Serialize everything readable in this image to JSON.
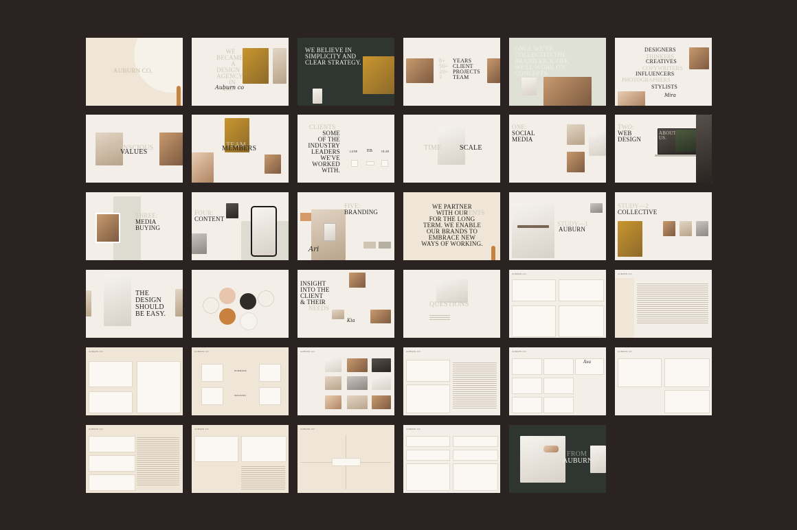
{
  "colors": {
    "background": "#2b2322",
    "cream": "#f3efe8",
    "sand": "#efe6d7",
    "dark_slide": "#2f3530",
    "accent_orange": "#c9813f"
  },
  "slides": {
    "s01": {
      "title": "AUBURN CO."
    },
    "s02": {
      "title": "WE BECAME A DESIGN AGENCY IN 2007",
      "signature": "Auburn co"
    },
    "s03": {
      "title": "WE BELIEVE IN SIMPLICITY AND CLEAR STRATEGY."
    },
    "s04": {
      "numbers": "8+\n50+\n20+\n3",
      "title": "YEARS\nCLIENT\nPROJECTS\nTEAM"
    },
    "s05": {
      "title": "ONCE WE'VE COLLECTED THE BRAND KICK-OFF, WE'LL WORK ON CONCEPTS"
    },
    "s06": {
      "title_1": "DESIGNERS",
      "ghost_1": "THINKERS",
      "title_2": "CREATIVES",
      "ghost_2": "COPYWRITERS",
      "title_3": "INFLUENCERS",
      "ghost_3": "PHOTOGRAPHERS",
      "title_4": "STYLISTS",
      "signature": "Mira"
    },
    "s07": {
      "ghost": "CONSCIOUS",
      "title": "VALUES"
    },
    "s08": {
      "ghost": "TEAM",
      "title": "MEMBERS"
    },
    "s09": {
      "ghost": "CLIENTS",
      "title": "SOME\nOF THE\nINDUSTRY\nLEADERS\nWE'VE\nWORKED\nWITH.",
      "logos": [
        "LUNE",
        "EB",
        "OLAE",
        "",
        "",
        ""
      ]
    },
    "s10": {
      "ghost": "TIME",
      "title": "SCALE"
    },
    "s11": {
      "ghost": "ONE:",
      "title": "SOCIAL\nMEDIA"
    },
    "s12": {
      "ghost": "TWO:",
      "title": "WEB\nDESIGN",
      "ghost_2": "ABOUT\nUS."
    },
    "s13": {
      "ghost": "THREE:",
      "title": "MEDIA\nBUYING"
    },
    "s14": {
      "ghost": "FOUR:",
      "title": "CONTENT"
    },
    "s15": {
      "ghost": "FIVE:",
      "title": "BRANDING",
      "signature": "Ari"
    },
    "s16": {
      "title_1": "WE PARTNER\nWITH OUR",
      "ghost": "CLIENTS",
      "title_2": "FOR THE LONG\nTERM. WE ENABLE\nOUR BRANDS TO\nEMBRACE NEW\nWAYS OF WORKING."
    },
    "s17": {
      "ghost": "STUDY—1",
      "title": "AUBURN"
    },
    "s18": {
      "ghost": "STUDY—2",
      "title": "COLLECTIVE"
    },
    "s19": {
      "title": "THE\nDESIGN\nSHOULD\nBE EASY."
    },
    "s20": {
      "circles": [
        "",
        "",
        "",
        ""
      ]
    },
    "s21": {
      "title": "INSIGHT\nINTO THE\nCLIENT\n& THEIR",
      "ghost": "NEEDS",
      "signature": "Kia"
    },
    "s22": {
      "ghost": "QUESTIONS"
    },
    "s23": {
      "header": "AUBURN CO."
    },
    "s24": {
      "header": "AUBURN CO."
    },
    "s25": {
      "header": "AUBURN CO."
    },
    "s26": {
      "header": "AUBURN CO.",
      "label_1": "AUDIENCE",
      "label_2": "INDUSTRY"
    },
    "s27": {
      "header": "AUBURN CO."
    },
    "s28": {
      "header": "AUBURN CO."
    },
    "s29": {
      "header": "AUBURN CO.",
      "signature": "Ava"
    },
    "s30": {
      "header": "AUBURN CO."
    },
    "s31": {
      "header": "AUBURN CO."
    },
    "s32": {
      "header": "AUBURN CO."
    },
    "s33": {
      "header": "AUBURN CO."
    },
    "s34": {
      "header": "AUBURN CO."
    },
    "s35": {
      "ghost": "FROM",
      "title": "AUBURN"
    }
  }
}
